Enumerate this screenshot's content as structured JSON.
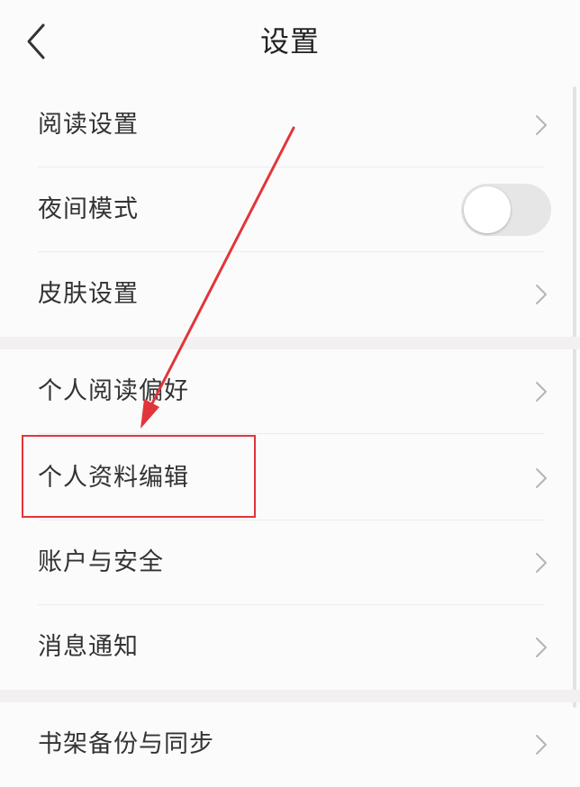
{
  "header": {
    "title": "设置"
  },
  "settings": {
    "reading_settings": "阅读设置",
    "night_mode": "夜间模式",
    "night_mode_enabled": false,
    "skin_settings": "皮肤设置",
    "personal_reading_preference": "个人阅读偏好",
    "edit_profile": "个人资料编辑",
    "account_security": "账户与安全",
    "notifications": "消息通知",
    "bookshelf_backup_sync": "书架备份与同步"
  },
  "icons": {
    "back": "chevron-left-icon",
    "row_arrow": "chevron-right-icon"
  },
  "colors": {
    "background": "#fcfbfb",
    "section_gap": "#f2f0f0",
    "annotation_red": "#e2353a",
    "text": "#333333",
    "chevron": "#b5b5b5",
    "toggle_off": "#e6e6e6"
  }
}
